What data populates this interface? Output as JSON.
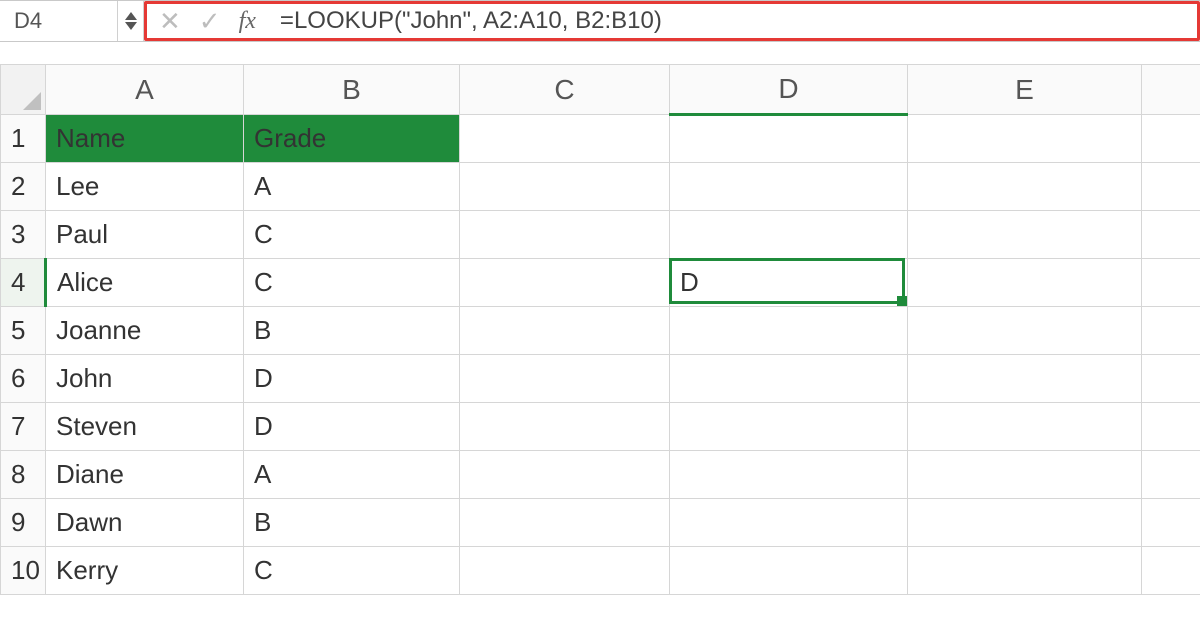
{
  "formula_bar": {
    "cell_ref": "D4",
    "cancel_glyph": "✕",
    "confirm_glyph": "✓",
    "fx_label": "fx",
    "formula": "=LOOKUP(\"John\", A2:A10, B2:B10)"
  },
  "columns": [
    "A",
    "B",
    "C",
    "D",
    "E"
  ],
  "row_numbers": [
    1,
    2,
    3,
    4,
    5,
    6,
    7,
    8,
    9,
    10
  ],
  "headers": {
    "A": "Name",
    "B": "Grade"
  },
  "rows": [
    {
      "A": "Lee",
      "B": "A"
    },
    {
      "A": "Paul",
      "B": "C"
    },
    {
      "A": "Alice",
      "B": "C"
    },
    {
      "A": "Joanne",
      "B": "B"
    },
    {
      "A": "John",
      "B": "D"
    },
    {
      "A": "Steven",
      "B": "D"
    },
    {
      "A": "Diane",
      "B": "A"
    },
    {
      "A": "Dawn",
      "B": "B"
    },
    {
      "A": "Kerry",
      "B": "C"
    }
  ],
  "active_cell": {
    "ref": "D4",
    "value": "D"
  },
  "colors": {
    "table_header": "#1f8b3b",
    "selection": "#1f8b3b",
    "highlight_box": "#e53935"
  }
}
